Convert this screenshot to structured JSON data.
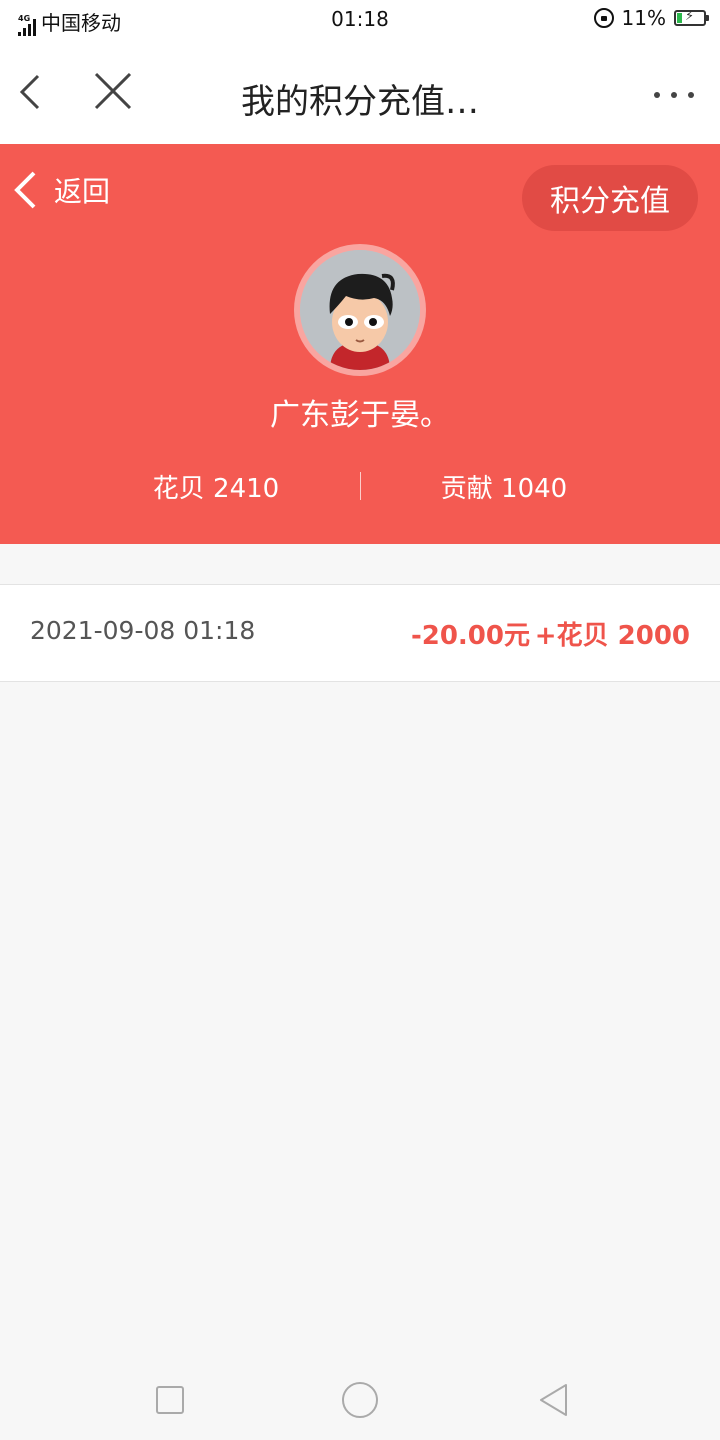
{
  "status_bar": {
    "network": "4G",
    "carrier": "中国移动",
    "time": "01:18",
    "battery": "11%"
  },
  "nav": {
    "title": "我的积分充值…",
    "back_icon": "chevron-left-icon",
    "close_icon": "close-icon",
    "more_icon": "more-icon"
  },
  "header": {
    "background_color": "#f45a52",
    "back_label": "返回",
    "recharge_label": "积分充值",
    "username": "广东彭于晏。",
    "stat_left": "花贝 2410",
    "stat_right": "贡献 1040"
  },
  "records": [
    {
      "datetime": "2021-09-08 01:18",
      "amount": "-20.00元",
      "points": "+花贝 2000"
    }
  ]
}
